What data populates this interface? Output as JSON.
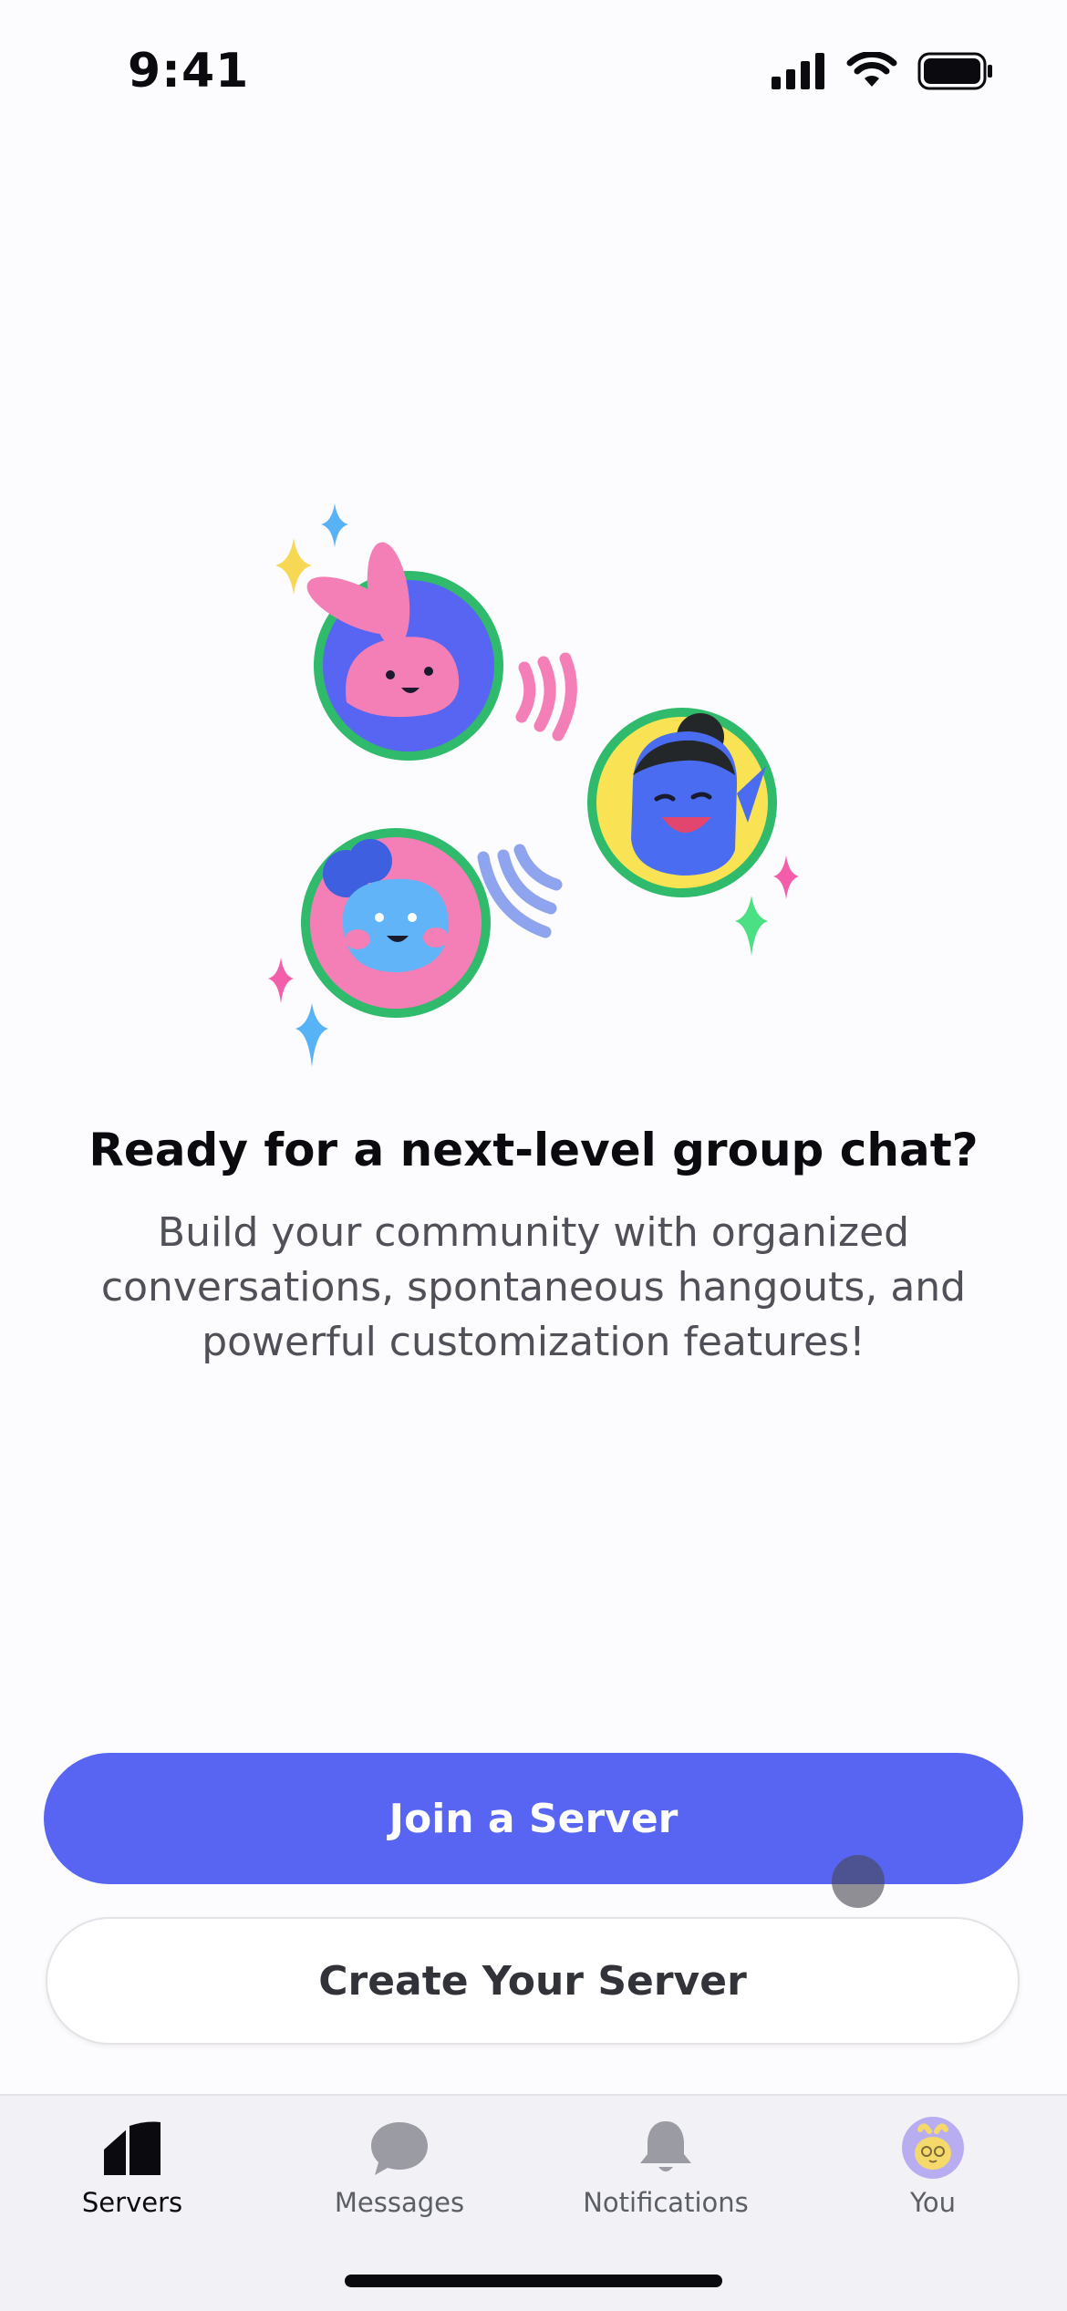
{
  "status_bar": {
    "time": "9:41"
  },
  "empty_state": {
    "headline": "Ready for a next-level group chat?",
    "subtitle": "Build your community with organized conversations, spontaneous hangouts, and powerful customization features!"
  },
  "actions": {
    "primary_label": "Join a Server",
    "secondary_label": "Create Your Server"
  },
  "tab_bar": {
    "tabs": [
      {
        "label": "Servers",
        "icon": "servers-icon",
        "active": true
      },
      {
        "label": "Messages",
        "icon": "chat-bubble-icon",
        "active": false
      },
      {
        "label": "Notifications",
        "icon": "bell-icon",
        "active": false
      },
      {
        "label": "You",
        "icon": "avatar",
        "active": false
      }
    ]
  },
  "colors": {
    "brand": "#5865f2",
    "background": "#fcfbfd",
    "tab_bar": "#f2f1f6"
  }
}
